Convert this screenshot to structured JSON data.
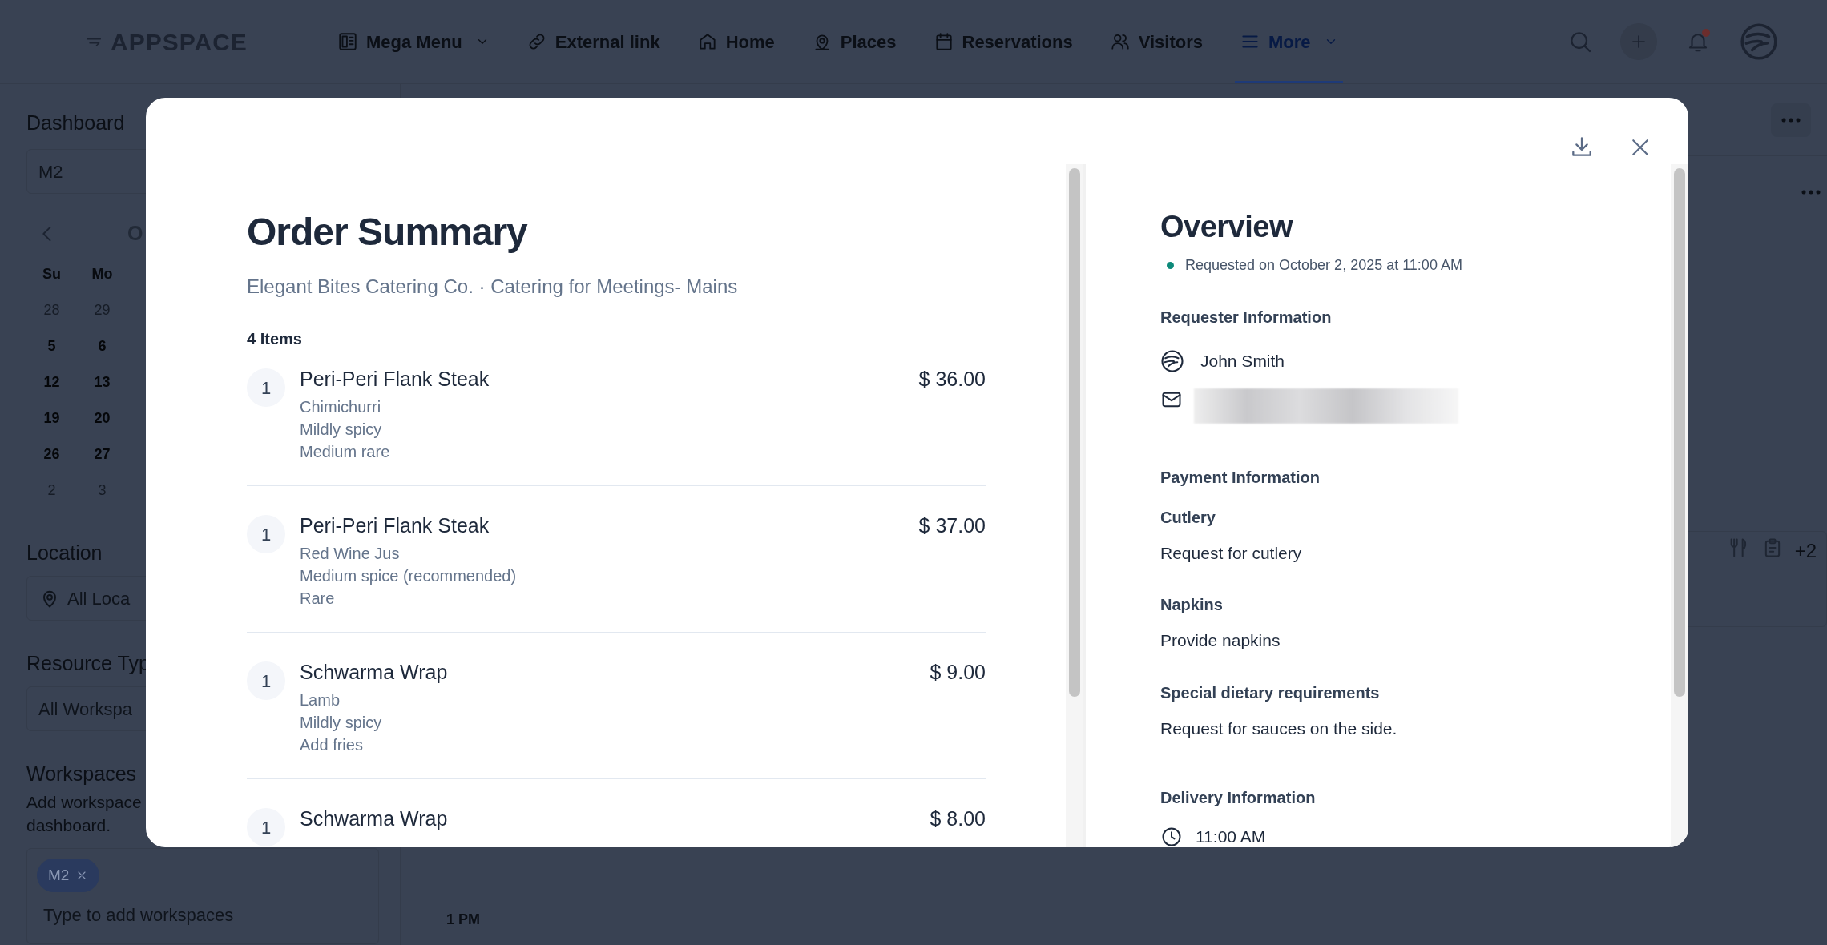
{
  "nav": {
    "logo": "APPSPACE",
    "items": [
      {
        "label": "Mega Menu",
        "kind": "board",
        "dropdown": true,
        "selected": false
      },
      {
        "label": "External link",
        "kind": "link",
        "dropdown": false,
        "selected": false
      },
      {
        "label": "Home",
        "kind": "home",
        "dropdown": false,
        "selected": false
      },
      {
        "label": "Places",
        "kind": "pin",
        "dropdown": false,
        "selected": false
      },
      {
        "label": "Reservations",
        "kind": "calendar",
        "dropdown": false,
        "selected": false
      },
      {
        "label": "Visitors",
        "kind": "people",
        "dropdown": false,
        "selected": false
      },
      {
        "label": "More",
        "kind": "menu",
        "dropdown": true,
        "selected": true
      }
    ],
    "has_notification": true
  },
  "sidebar": {
    "dashboard_label": "Dashboard",
    "dashboard_value": "M2",
    "calendar": {
      "month": "O",
      "weekdays": [
        "Su",
        "Mo"
      ],
      "weeks": [
        [
          {
            "day": "28",
            "outside": true
          },
          {
            "day": "29",
            "outside": true
          }
        ],
        [
          {
            "day": "5",
            "outside": false
          },
          {
            "day": "6",
            "outside": false
          }
        ],
        [
          {
            "day": "12",
            "outside": false
          },
          {
            "day": "13",
            "outside": false
          }
        ],
        [
          {
            "day": "19",
            "outside": false
          },
          {
            "day": "20",
            "outside": false
          }
        ],
        [
          {
            "day": "26",
            "outside": false
          },
          {
            "day": "27",
            "outside": false
          }
        ],
        [
          {
            "day": "2",
            "outside": true
          },
          {
            "day": "3",
            "outside": true
          }
        ]
      ]
    },
    "location_label": "Location",
    "location_value": "All Loca",
    "resource_label": "Resource Typ",
    "resource_value": "All Workspa",
    "workspaces_label": "Workspaces",
    "workspaces_help": [
      "Add workspace",
      "dashboard."
    ],
    "chips": [
      "M2"
    ],
    "workspaces_placeholder": "Type to add workspaces"
  },
  "schedule": {
    "time_label": "1 PM",
    "more_tags": "+2"
  },
  "order": {
    "title": "Order Summary",
    "subtitle": "Elegant Bites Catering Co. · Catering for Meetings- Mains",
    "count": "4 Items",
    "items": [
      {
        "qty": "1",
        "name": "Peri-Peri Flank Steak",
        "price": "$ 36.00",
        "options": [
          "Chimichurri",
          "Mildly spicy",
          "Medium rare"
        ]
      },
      {
        "qty": "1",
        "name": "Peri-Peri Flank Steak",
        "price": "$ 37.00",
        "options": [
          "Red Wine Jus",
          "Medium spice (recommended)",
          "Rare"
        ]
      },
      {
        "qty": "1",
        "name": "Schwarma Wrap",
        "price": "$ 9.00",
        "options": [
          "Lamb",
          "Mildly spicy",
          "Add fries"
        ]
      },
      {
        "qty": "1",
        "name": "Schwarma Wrap",
        "price": "$ 8.00"
      }
    ]
  },
  "overview": {
    "title": "Overview",
    "requested": "Requested on October 2, 2025 at 11:00 AM",
    "requester_heading": "Requester Information",
    "requester_name": "John Smith",
    "payment_heading": "Payment Information",
    "fields": [
      {
        "label": "Cutlery",
        "value": "Request for cutlery"
      },
      {
        "label": "Napkins",
        "value": "Provide napkins"
      },
      {
        "label": "Special dietary requirements",
        "value": "Request for sauces on the side."
      }
    ],
    "delivery_heading": "Delivery Information",
    "delivery_time": "11:00 AM"
  }
}
